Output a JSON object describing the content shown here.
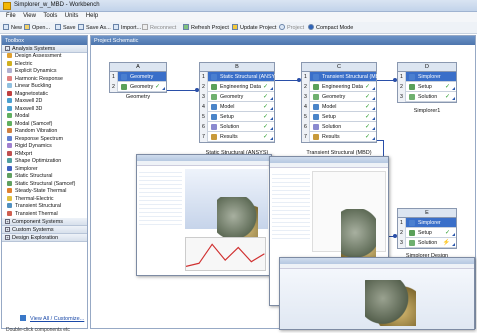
{
  "window": {
    "title": "Simplorer_w_MBD - Workbench"
  },
  "menu": [
    "File",
    "View",
    "Tools",
    "Units",
    "Help"
  ],
  "toolbar": {
    "new": "New",
    "open": "Open...",
    "save": "Save",
    "saveas": "Save As...",
    "import": "Import...",
    "reconnect": "Reconnect",
    "refresh": "Refresh Project",
    "update": "Update Project",
    "project": "Project",
    "compact": "Compact Mode"
  },
  "toolbox": {
    "title": "Toolbox",
    "analysis_header": "Analysis Systems",
    "items": [
      "Design Assessment",
      "Electric",
      "Explicit Dynamics",
      "Harmonic Response",
      "Linear Buckling",
      "Magnetostatic",
      "Maxwell 2D",
      "Maxwell 3D",
      "Modal",
      "Modal (Samcef)",
      "Random Vibration",
      "Response Spectrum",
      "Rigid Dynamics",
      "RMxprt",
      "Shape Optimization",
      "Simplorer",
      "Static Structural",
      "Static Structural (Samcef)",
      "Steady-State Thermal",
      "Thermal-Electric",
      "Transient Structural",
      "Transient Thermal"
    ],
    "groups": [
      "Component Systems",
      "Custom Systems",
      "Design Exploration"
    ],
    "view_all": "View All / Customize...",
    "show_messages": "Double-click components etc"
  },
  "schematic": {
    "title": "Project Schematic",
    "systems": {
      "A": {
        "letter": "A",
        "rows": [
          "Geometry",
          "Geometry"
        ],
        "caption": "Geometry"
      },
      "B": {
        "letter": "B",
        "rows": [
          "Static Structural (ANSYS)",
          "Engineering Data",
          "Geometry",
          "Model",
          "Setup",
          "Solution",
          "Results"
        ],
        "caption": "Static Structural (ANSYS)"
      },
      "C": {
        "letter": "C",
        "rows": [
          "Transient Structural (MBD)",
          "Engineering Data",
          "Geometry",
          "Model",
          "Setup",
          "Solution",
          "Results"
        ],
        "caption": "Transient Structural (MBD)"
      },
      "D": {
        "letter": "D",
        "rows": [
          "Simplorer",
          "Setup",
          "Solution"
        ],
        "caption": "Simplorer1"
      },
      "E": {
        "letter": "E",
        "rows": [
          "Simplorer",
          "Setup",
          "Solution"
        ],
        "caption": "Simplorer Design"
      }
    }
  },
  "colors": {
    "accent": "#3a6fc9",
    "header": "#4d75ad",
    "check": "#2a9a2a"
  }
}
